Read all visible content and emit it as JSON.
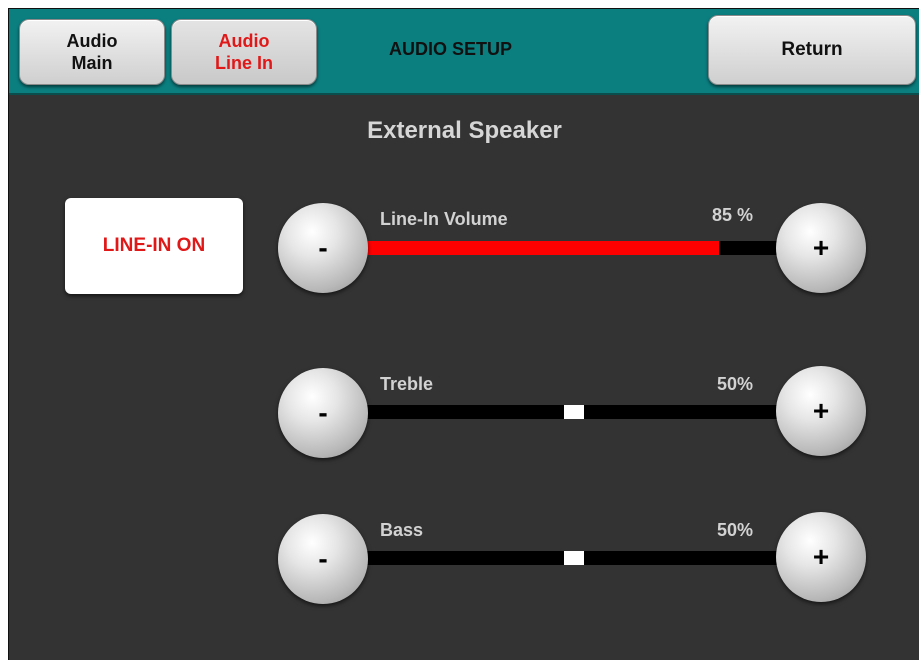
{
  "header": {
    "tabs": [
      {
        "label": "Audio\nMain",
        "active": false
      },
      {
        "label": "Audio\nLine In",
        "active": true
      }
    ],
    "title": "AUDIO SETUP",
    "return_label": "Return"
  },
  "section_title": "External Speaker",
  "line_in_button": "LINE-IN ON",
  "sliders": [
    {
      "label": "Line-In Volume",
      "value_text": "85 %",
      "level": 0.85,
      "style": "fill"
    },
    {
      "label": "Treble",
      "value_text": "50%",
      "level": 0.5,
      "style": "thumb"
    },
    {
      "label": "Bass",
      "value_text": "50%",
      "level": 0.5,
      "style": "thumb"
    }
  ],
  "buttons": {
    "minus": "-",
    "plus": "+"
  },
  "colors": {
    "header_bg": "#0b7f80",
    "panel_bg": "#333333",
    "active_text": "#e01818",
    "volume_fill": "#ff0000"
  }
}
